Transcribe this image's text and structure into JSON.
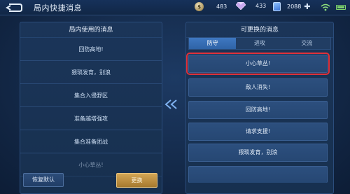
{
  "header": {
    "title": "局内快捷消息",
    "gold": "483",
    "gems": "433",
    "cards": "2088"
  },
  "left_panel": {
    "title": "局内使用的消息",
    "items": [
      "回防高地!",
      "猥琐发育，别浪",
      "集合入侵野区",
      "准备越塔强攻",
      "集合准备团战",
      "小心草丛!"
    ],
    "reset_label": "恢复默认",
    "replace_label": "更换"
  },
  "right_panel": {
    "title": "可更换的消息",
    "tabs": [
      "防守",
      "进攻",
      "交流"
    ],
    "active_tab": "防守",
    "options": [
      "小心草丛!",
      "敌人消失!",
      "回防高地!",
      "请求支援!",
      "猥琐发育，别浪"
    ],
    "selected_index": 0
  },
  "colors": {
    "accent": "#d3a554",
    "highlight": "#e0313a",
    "tab_active": "#3f78c1"
  }
}
